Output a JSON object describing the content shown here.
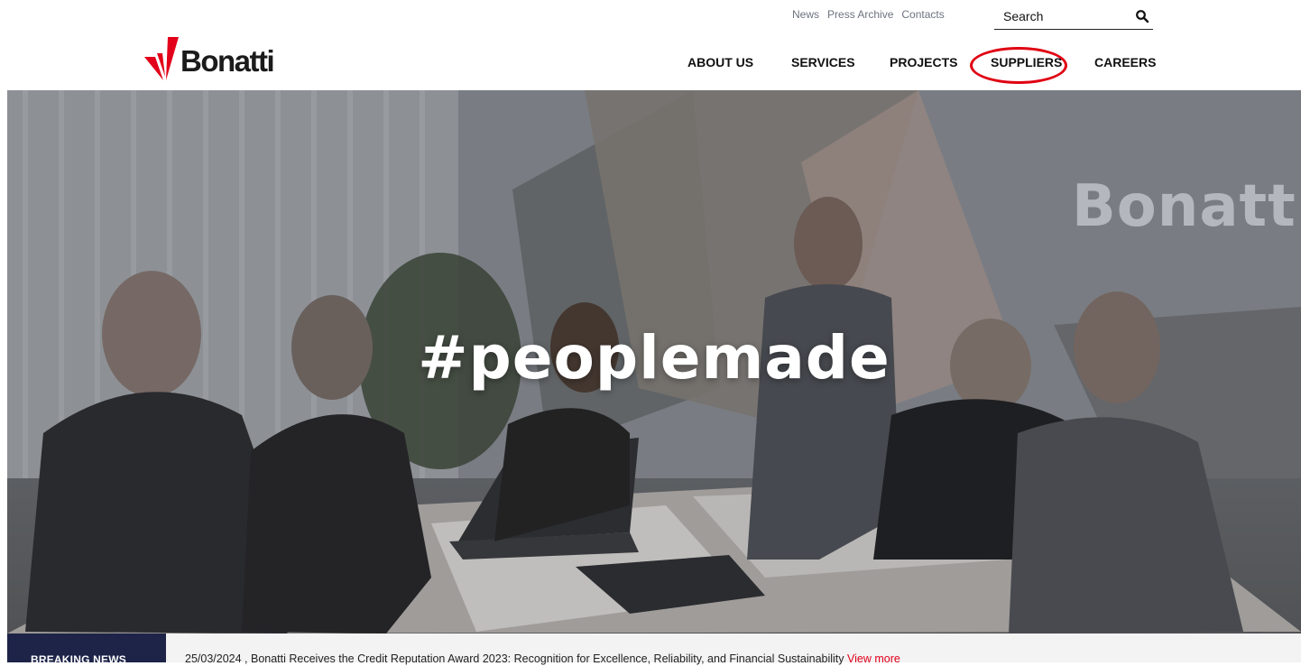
{
  "header": {
    "utility_links": [
      "News",
      "Press Archive",
      "Contacts"
    ],
    "search": {
      "placeholder": "Search"
    },
    "logo_text": "Bonatti",
    "nav": [
      "ABOUT US",
      "SERVICES",
      "PROJECTS",
      "SUPPLIERS",
      "CAREERS"
    ],
    "highlighted_nav_item": "SUPPLIERS"
  },
  "hero": {
    "headline": "#peoplemade",
    "wall_logo_text": "Bonatti"
  },
  "breaking_news": {
    "label": "BREAKING NEWS",
    "text": "25/03/2024 , Bonatti Receives the Credit Reputation Award 2023: Recognition for Excellence, Reliability, and Financial Sustainability",
    "link_label": "View more"
  },
  "colors": {
    "brand_red": "#e2001a",
    "navy": "#1d2448",
    "annotation_circle": "#e00012"
  }
}
